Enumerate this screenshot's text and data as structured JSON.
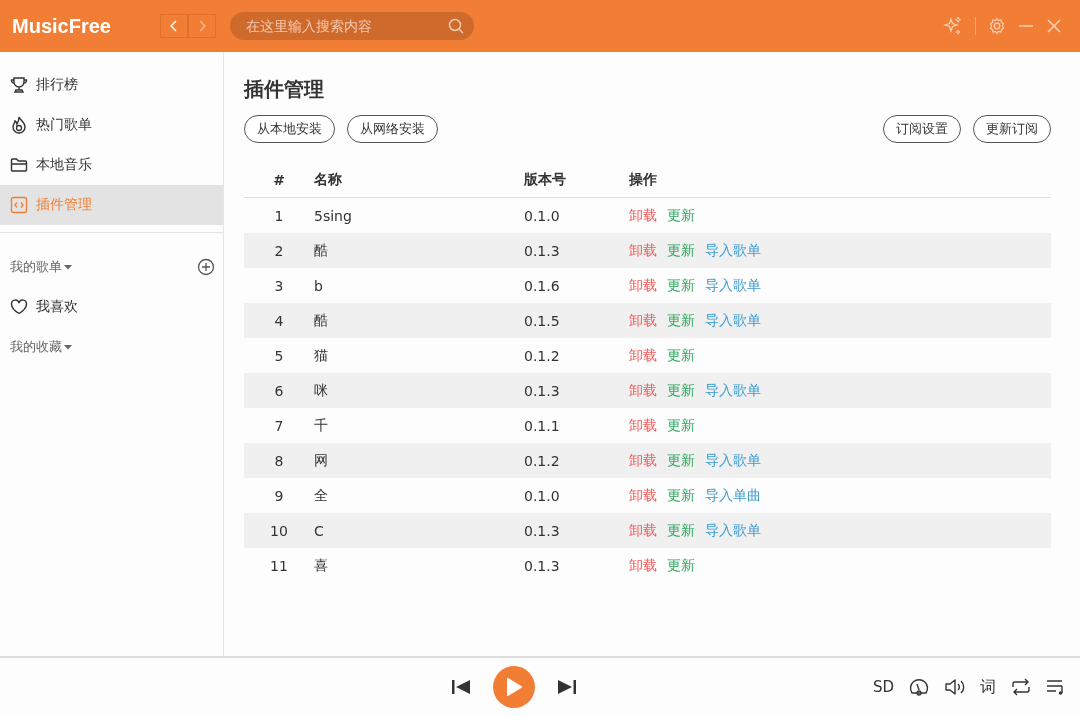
{
  "header": {
    "logo": "MusicFree",
    "search": {
      "placeholder": "在这里输入搜索内容"
    }
  },
  "sidebar": {
    "items": [
      {
        "label": "排行榜",
        "selected": false
      },
      {
        "label": "热门歌单",
        "selected": false
      },
      {
        "label": "本地音乐",
        "selected": false
      },
      {
        "label": "插件管理",
        "selected": true
      }
    ],
    "my_playlists": "我的歌单",
    "favorites": "我喜欢",
    "my_collections": "我的收藏"
  },
  "page": {
    "title": "插件管理",
    "left_buttons": [
      "从本地安装",
      "从网络安装"
    ],
    "right_buttons": [
      "订阅设置",
      "更新订阅"
    ],
    "table": {
      "columns": [
        "#",
        "名称",
        "版本号",
        "操作"
      ],
      "rows": [
        {
          "index": "1",
          "name": "5sing",
          "version": "0.1.0",
          "actions": [
            {
              "kind": "uninstall",
              "label": "卸载"
            },
            {
              "kind": "update",
              "label": "更新"
            }
          ]
        },
        {
          "index": "2",
          "name": "酷",
          "version": "0.1.3",
          "actions": [
            {
              "kind": "uninstall",
              "label": "卸载"
            },
            {
              "kind": "update",
              "label": "更新"
            },
            {
              "kind": "import",
              "label": "导入歌单"
            }
          ]
        },
        {
          "index": "3",
          "name": "b",
          "version": "0.1.6",
          "actions": [
            {
              "kind": "uninstall",
              "label": "卸载"
            },
            {
              "kind": "update",
              "label": "更新"
            },
            {
              "kind": "import",
              "label": "导入歌单"
            }
          ]
        },
        {
          "index": "4",
          "name": "酷",
          "version": "0.1.5",
          "actions": [
            {
              "kind": "uninstall",
              "label": "卸载"
            },
            {
              "kind": "update",
              "label": "更新"
            },
            {
              "kind": "import",
              "label": "导入歌单"
            }
          ]
        },
        {
          "index": "5",
          "name": "猫",
          "version": "0.1.2",
          "actions": [
            {
              "kind": "uninstall",
              "label": "卸载"
            },
            {
              "kind": "update",
              "label": "更新"
            }
          ]
        },
        {
          "index": "6",
          "name": "咪",
          "version": "0.1.3",
          "actions": [
            {
              "kind": "uninstall",
              "label": "卸载"
            },
            {
              "kind": "update",
              "label": "更新"
            },
            {
              "kind": "import",
              "label": "导入歌单"
            }
          ]
        },
        {
          "index": "7",
          "name": "千",
          "version": "0.1.1",
          "actions": [
            {
              "kind": "uninstall",
              "label": "卸载"
            },
            {
              "kind": "update",
              "label": "更新"
            }
          ]
        },
        {
          "index": "8",
          "name": "网",
          "version": "0.1.2",
          "actions": [
            {
              "kind": "uninstall",
              "label": "卸载"
            },
            {
              "kind": "update",
              "label": "更新"
            },
            {
              "kind": "import",
              "label": "导入歌单"
            }
          ]
        },
        {
          "index": "9",
          "name": "全",
          "version": "0.1.0",
          "actions": [
            {
              "kind": "uninstall",
              "label": "卸载"
            },
            {
              "kind": "update",
              "label": "更新"
            },
            {
              "kind": "import",
              "label": "导入单曲"
            }
          ]
        },
        {
          "index": "10",
          "name": "C",
          "version": "0.1.3",
          "actions": [
            {
              "kind": "uninstall",
              "label": "卸载"
            },
            {
              "kind": "update",
              "label": "更新"
            },
            {
              "kind": "import",
              "label": "导入歌单"
            }
          ]
        },
        {
          "index": "11",
          "name": "喜",
          "version": "0.1.3",
          "actions": [
            {
              "kind": "uninstall",
              "label": "卸载"
            },
            {
              "kind": "update",
              "label": "更新"
            }
          ]
        }
      ]
    }
  },
  "player": {
    "quality": "SD",
    "lyrics": "词"
  }
}
